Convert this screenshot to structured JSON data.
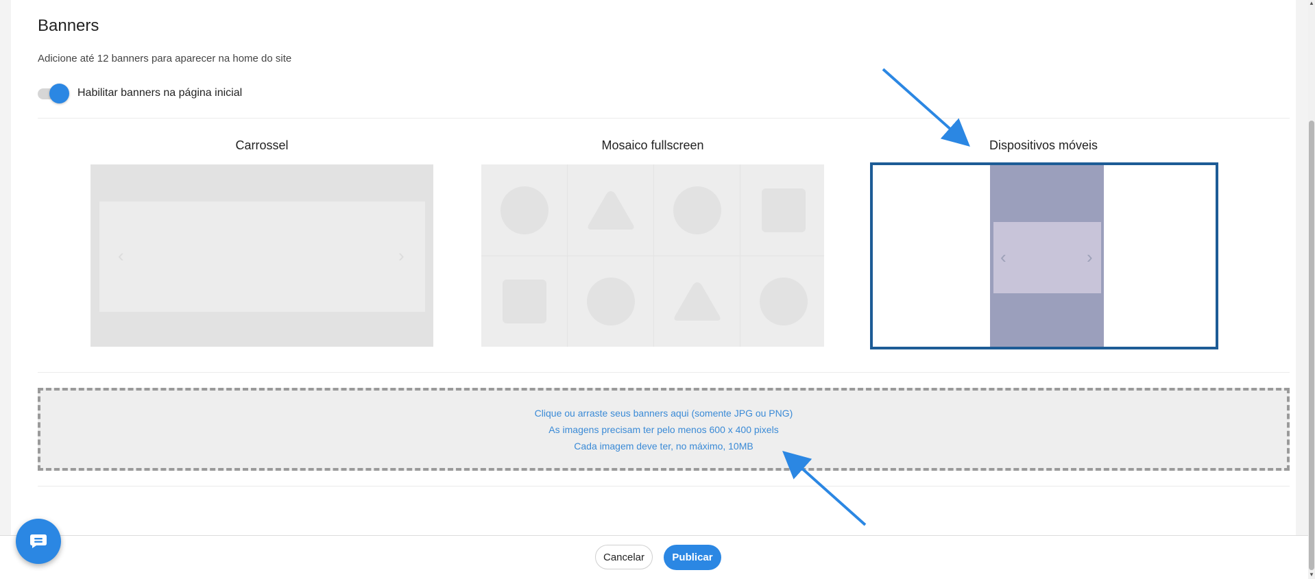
{
  "header": {
    "title": "Banners",
    "subtitle": "Adicione até 12 banners para aparecer na home do site"
  },
  "toggle": {
    "label": "Habilitar banners na página inicial",
    "enabled": true
  },
  "layout_options": [
    {
      "label": "Carrossel",
      "selected": false
    },
    {
      "label": "Mosaico fullscreen",
      "selected": false
    },
    {
      "label": "Dispositivos móveis",
      "selected": true
    }
  ],
  "dropzone": {
    "line1": "Clique ou arraste seus banners aqui (somente JPG ou PNG)",
    "line2": "As imagens precisam ter pelo menos 600 x 400 pixels",
    "line3": "Cada imagem deve ter, no máximo,  10MB"
  },
  "footer": {
    "cancel_label": "Cancelar",
    "publish_label": "Publicar"
  },
  "icons": {
    "chevron_left": "‹",
    "chevron_right": "›",
    "scroll_up": "▲",
    "scroll_down": "▼"
  },
  "colors": {
    "primary": "#2b87e3",
    "selected_border": "#1d5c96",
    "dropzone_text": "#3a8ad6",
    "annotation_arrow": "#2b87e3"
  }
}
